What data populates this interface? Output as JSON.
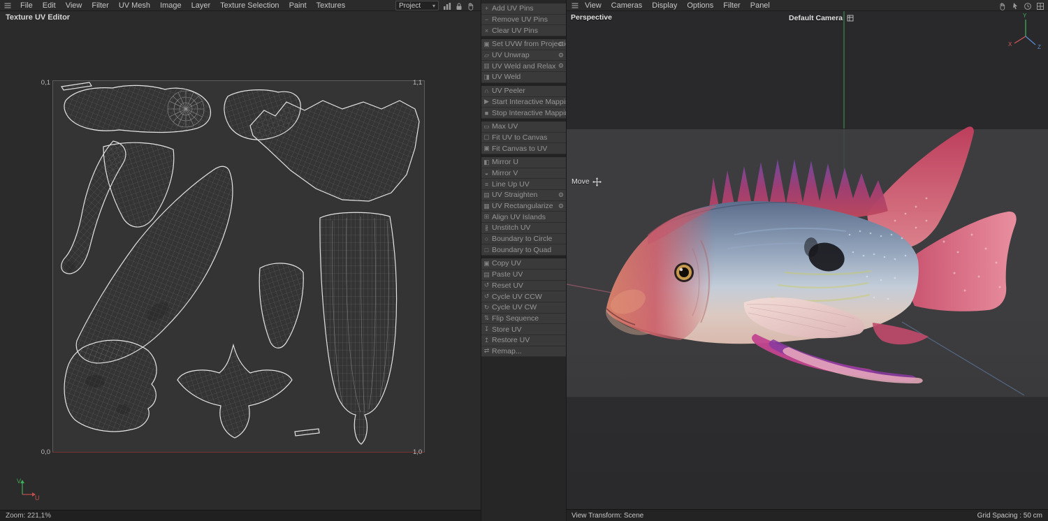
{
  "menubar": {
    "items": [
      "File",
      "Edit",
      "View",
      "Filter",
      "UV Mesh",
      "Image",
      "Layer",
      "Texture Selection",
      "Paint",
      "Textures"
    ],
    "project_dropdown": "Project"
  },
  "uv_editor": {
    "title": "Texture UV Editor",
    "corners": {
      "tl": "0,1",
      "tr": "1,1",
      "bl": "0,0",
      "br": "1,0"
    },
    "zoom_status": "Zoom: 221,1%",
    "axis": {
      "u": "U",
      "v": "V"
    }
  },
  "uv_commands": {
    "gear_glyph": "⚙",
    "items": [
      {
        "label": "Add UV Pins",
        "glyph": "+"
      },
      {
        "label": "Remove UV Pins",
        "glyph": "−"
      },
      {
        "label": "Clear UV Pins",
        "glyph": "×"
      },
      {
        "label": "Set UVW from Projection",
        "glyph": "▣",
        "gear": true
      },
      {
        "label": "UV Unwrap",
        "glyph": "▱",
        "gear": true
      },
      {
        "label": "UV Weld and Relax",
        "glyph": "▥",
        "gear": true
      },
      {
        "label": "UV Weld",
        "glyph": "◨"
      },
      {
        "label": "UV Peeler",
        "glyph": "∩"
      },
      {
        "label": "Start Interactive Mapping",
        "glyph": "▶"
      },
      {
        "label": "Stop Interactive Mapping",
        "glyph": "■"
      },
      {
        "label": "Max UV",
        "glyph": "▭"
      },
      {
        "label": "Fit UV to Canvas",
        "glyph": "▢"
      },
      {
        "label": "Fit Canvas to UV",
        "glyph": "▣"
      },
      {
        "label": "Mirror U",
        "glyph": "◧"
      },
      {
        "label": "Mirror V",
        "glyph": "◒"
      },
      {
        "label": "Line Up UV",
        "glyph": "≡"
      },
      {
        "label": "UV Straighten",
        "glyph": "▤",
        "gear": true
      },
      {
        "label": "UV Rectangularize",
        "glyph": "▦",
        "gear": true
      },
      {
        "label": "Align UV Islands",
        "glyph": "⊞"
      },
      {
        "label": "Unstitch UV",
        "glyph": "∦"
      },
      {
        "label": "Boundary to Circle",
        "glyph": "○"
      },
      {
        "label": "Boundary to Quad",
        "glyph": "□"
      },
      {
        "label": "Copy UV",
        "glyph": "▣"
      },
      {
        "label": "Paste UV",
        "glyph": "▤"
      },
      {
        "label": "Reset UV",
        "glyph": "↺"
      },
      {
        "label": "Cycle UV CCW",
        "glyph": "↺"
      },
      {
        "label": "Cycle UV CW",
        "glyph": "↻"
      },
      {
        "label": "Flip Sequence",
        "glyph": "⇅"
      },
      {
        "label": "Store UV",
        "glyph": "↧"
      },
      {
        "label": "Restore UV",
        "glyph": "↥"
      },
      {
        "label": "Remap...",
        "glyph": "⇄"
      }
    ]
  },
  "viewport": {
    "menu_items": [
      "View",
      "Cameras",
      "Display",
      "Options",
      "Filter",
      "Panel"
    ],
    "view_label": "Perspective",
    "camera_label": "Default Camera",
    "tool_label": "Move",
    "status_left": "View Transform: Scene",
    "status_right": "Grid Spacing : 50 cm",
    "axis": {
      "x": "X",
      "y": "Y",
      "z": "Z"
    }
  },
  "colors": {
    "axis_green": "#4aa85e",
    "axis_red": "#d05a5a",
    "axis_blue": "#5a8ad0"
  }
}
